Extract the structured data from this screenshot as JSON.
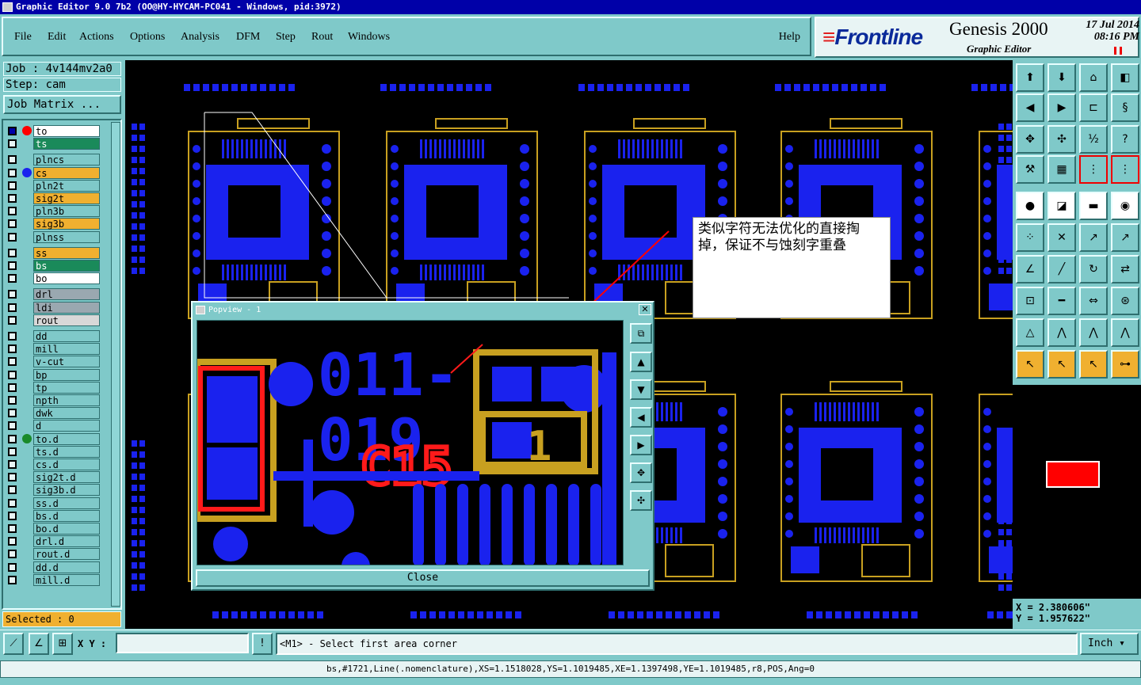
{
  "window": {
    "title": "Graphic Editor 9.0 7b2 (OO@HY-HYCAM-PC041 - Windows, pid:3972)"
  },
  "menu": {
    "items": [
      "File",
      "Edit",
      "Actions",
      "Options",
      "Analysis",
      "DFM",
      "Step",
      "Rout",
      "Windows"
    ],
    "help": "Help"
  },
  "brand": {
    "logo": "Frontline",
    "product": "Genesis 2000",
    "subtitle": "Graphic Editor",
    "date": "17 Jul 2014",
    "time": "08:16 PM"
  },
  "job": {
    "job_label": "Job : 4v144mv2a0",
    "step_label": "Step: cam",
    "matrix_button": "Job Matrix ..."
  },
  "layers": [
    {
      "name": "to",
      "bg": "#ffffff",
      "dot": "#ff0000",
      "checked": true
    },
    {
      "name": "ts",
      "bg": "#1a8a5a",
      "dot": "",
      "checked": false
    },
    {
      "name": "plncs",
      "bg": "#7fc9c9",
      "dot": "",
      "checked": false
    },
    {
      "name": "cs",
      "bg": "#f0b030",
      "dot": "#1a22ee",
      "checked": false
    },
    {
      "name": "pln2t",
      "bg": "#7fc9c9",
      "dot": "",
      "checked": false
    },
    {
      "name": "sig2t",
      "bg": "#f0b030",
      "dot": "",
      "checked": false
    },
    {
      "name": "pln3b",
      "bg": "#7fc9c9",
      "dot": "",
      "checked": false
    },
    {
      "name": "sig3b",
      "bg": "#f0b030",
      "dot": "",
      "checked": false
    },
    {
      "name": "plnss",
      "bg": "#7fc9c9",
      "dot": "",
      "checked": false
    },
    {
      "name": "ss",
      "bg": "#f0b030",
      "dot": "",
      "checked": false
    },
    {
      "name": "bs",
      "bg": "#1a8a5a",
      "dot": "",
      "checked": false
    },
    {
      "name": "bo",
      "bg": "#ffffff",
      "dot": "",
      "checked": false
    },
    {
      "name": "drl",
      "bg": "#9aa8b0",
      "dot": "",
      "checked": false
    },
    {
      "name": "ldi",
      "bg": "#9aa8b0",
      "dot": "",
      "checked": false
    },
    {
      "name": "rout",
      "bg": "#d8d8d8",
      "dot": "",
      "checked": false
    },
    {
      "name": "dd",
      "bg": "#7fc9c9",
      "dot": "",
      "checked": false
    },
    {
      "name": "mill",
      "bg": "#7fc9c9",
      "dot": "",
      "checked": false
    },
    {
      "name": "v-cut",
      "bg": "#7fc9c9",
      "dot": "",
      "checked": false
    },
    {
      "name": "bp",
      "bg": "#7fc9c9",
      "dot": "",
      "checked": false
    },
    {
      "name": "tp",
      "bg": "#7fc9c9",
      "dot": "",
      "checked": false
    },
    {
      "name": "npth",
      "bg": "#7fc9c9",
      "dot": "",
      "checked": false
    },
    {
      "name": "dwk",
      "bg": "#7fc9c9",
      "dot": "",
      "checked": false
    },
    {
      "name": "d",
      "bg": "#7fc9c9",
      "dot": "",
      "checked": false
    },
    {
      "name": "to.d",
      "bg": "#7fc9c9",
      "dot": "#1a8a2a",
      "checked": false
    },
    {
      "name": "ts.d",
      "bg": "#7fc9c9",
      "dot": "",
      "checked": false
    },
    {
      "name": "cs.d",
      "bg": "#7fc9c9",
      "dot": "",
      "checked": false
    },
    {
      "name": "sig2t.d",
      "bg": "#7fc9c9",
      "dot": "",
      "checked": false
    },
    {
      "name": "sig3b.d",
      "bg": "#7fc9c9",
      "dot": "",
      "checked": false
    },
    {
      "name": "ss.d",
      "bg": "#7fc9c9",
      "dot": "",
      "checked": false
    },
    {
      "name": "bs.d",
      "bg": "#7fc9c9",
      "dot": "",
      "checked": false
    },
    {
      "name": "bo.d",
      "bg": "#7fc9c9",
      "dot": "",
      "checked": false
    },
    {
      "name": "drl.d",
      "bg": "#7fc9c9",
      "dot": "",
      "checked": false
    },
    {
      "name": "rout.d",
      "bg": "#7fc9c9",
      "dot": "",
      "checked": false
    },
    {
      "name": "dd.d",
      "bg": "#7fc9c9",
      "dot": "",
      "checked": false
    },
    {
      "name": "mill.d",
      "bg": "#7fc9c9",
      "dot": "",
      "checked": false
    }
  ],
  "selected": "Selected : 0",
  "annotation": "类似字符无法优化的直接掏掉，保证不与蚀刻字重叠",
  "popview": {
    "title": "Popview - 1",
    "close": "Close",
    "pcb_text_line1": "011-",
    "pcb_text_line2": "019",
    "pcb_ref": "C15",
    "pcb_pin": "1"
  },
  "colors": {
    "copper": "#1a22ee",
    "silk": "#c8a020",
    "marker": "#ff0000",
    "panel": "#7fc9c9"
  },
  "coords": {
    "x": "X = 2.380606\"",
    "y": "Y = 1.957622\""
  },
  "bottom": {
    "xy_label": "X Y :",
    "xy_value": "",
    "prompt": "<M1> - Select first area corner",
    "units": "Inch"
  },
  "status_line": "bs,#1721,Line(.nomenclature),XS=1.1518028,YS=1.1019485,XE=1.1397498,YE=1.1019485,r8,POS,Ang=0"
}
